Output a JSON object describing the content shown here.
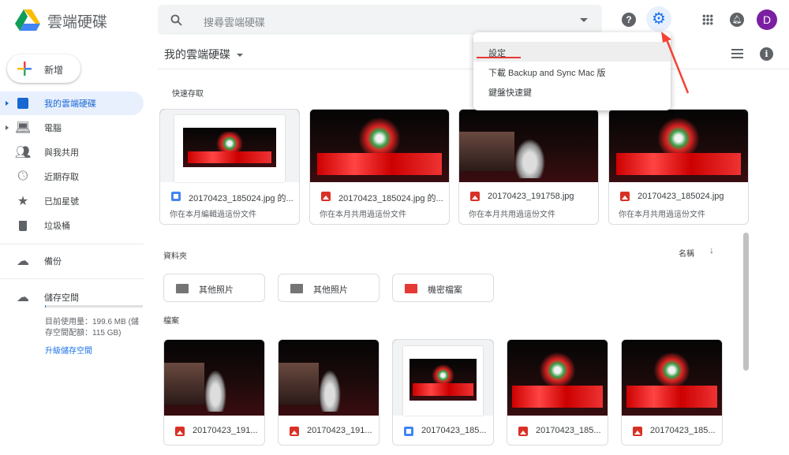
{
  "header": {
    "app_title": "雲端硬碟",
    "search_placeholder": "搜尋雲端硬碟",
    "avatar_letter": "D"
  },
  "toolbar": {
    "location": "我的雲端硬碟"
  },
  "settings_menu": {
    "items": [
      "設定",
      "下載 Backup and Sync Mac 版",
      "鍵盤快速鍵"
    ]
  },
  "sidebar": {
    "new_label": "新增",
    "items": [
      {
        "label": "我的雲端硬碟"
      },
      {
        "label": "電腦"
      },
      {
        "label": "與我共用"
      },
      {
        "label": "近期存取"
      },
      {
        "label": "已加星號"
      },
      {
        "label": "垃圾桶"
      }
    ],
    "backup": "備份",
    "storage": "儲存空間",
    "storage_usage": "目前使用量：199.6 MB (儲存空間配額：115 GB)",
    "storage_fraction": 0.002,
    "upgrade": "升級儲存空間"
  },
  "quick_access": {
    "title": "快速存取",
    "cards": [
      {
        "name": "20170423_185024.jpg 的...",
        "sub": "你在本月編輯過這份文件",
        "type": "doc"
      },
      {
        "name": "20170423_185024.jpg 的...",
        "sub": "你在本月共用過這份文件",
        "type": "image"
      },
      {
        "name": "20170423_191758.jpg",
        "sub": "你在本月共用過這份文件",
        "type": "image"
      },
      {
        "name": "20170423_185024.jpg",
        "sub": "你在本月共用過這份文件",
        "type": "image"
      }
    ]
  },
  "folders": {
    "title": "資料夾",
    "sort_label": "名稱",
    "items": [
      {
        "name": "其他照片"
      },
      {
        "name": "其他照片"
      },
      {
        "name": "機密檔案"
      }
    ]
  },
  "files": {
    "title": "檔案",
    "items": [
      {
        "name": "20170423_191...",
        "type": "image"
      },
      {
        "name": "20170423_191...",
        "type": "image"
      },
      {
        "name": "20170423_185...",
        "type": "doc"
      },
      {
        "name": "20170423_185...",
        "type": "image"
      },
      {
        "name": "20170423_185...",
        "type": "image"
      }
    ]
  }
}
